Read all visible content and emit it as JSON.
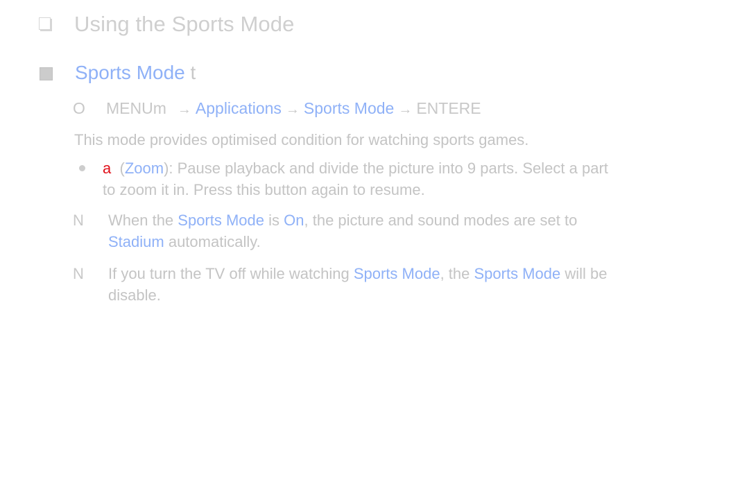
{
  "section": {
    "icon": "checkbox-icon",
    "title": "Using the Sports Mode"
  },
  "subsection": {
    "icon": "square-bullet-icon",
    "title": "Sports Mode",
    "suffix": "t"
  },
  "menu_path": {
    "icon_glyph": "O",
    "menu_label": "MENUm",
    "arrow": "→",
    "steps": [
      "Applications",
      "Sports Mode"
    ],
    "enter_label": "ENTERE"
  },
  "description": "This mode provides optimised condition for watching sports games.",
  "bullet": {
    "key_glyph": "a",
    "open_paren": "(",
    "button_name": "Zoom",
    "line1_rest": "): Pause playback and divide the picture into 9 parts. Select a part",
    "line2": "to zoom it in. Press this button again to resume."
  },
  "notes": [
    {
      "icon_glyph": "N",
      "line1": {
        "t1": "When the ",
        "h1": "Sports Mode",
        "t2": " is ",
        "h2": "On",
        "t3": ", the picture and sound modes are set to"
      },
      "line2": {
        "h1": "Stadium",
        "t1": " automatically."
      }
    },
    {
      "icon_glyph": "N",
      "line1": {
        "t1": "If you turn the TV off while watching ",
        "h1": "Sports Mode",
        "t2": ", the ",
        "h2": "Sports Mode",
        "t3": " will be"
      },
      "line2": {
        "t1": "disable."
      }
    }
  ],
  "colors": {
    "highlight": "#8fb1f7",
    "key_red": "#e0101a",
    "body_text": "#c4c4c4",
    "background": "#ffffff"
  }
}
